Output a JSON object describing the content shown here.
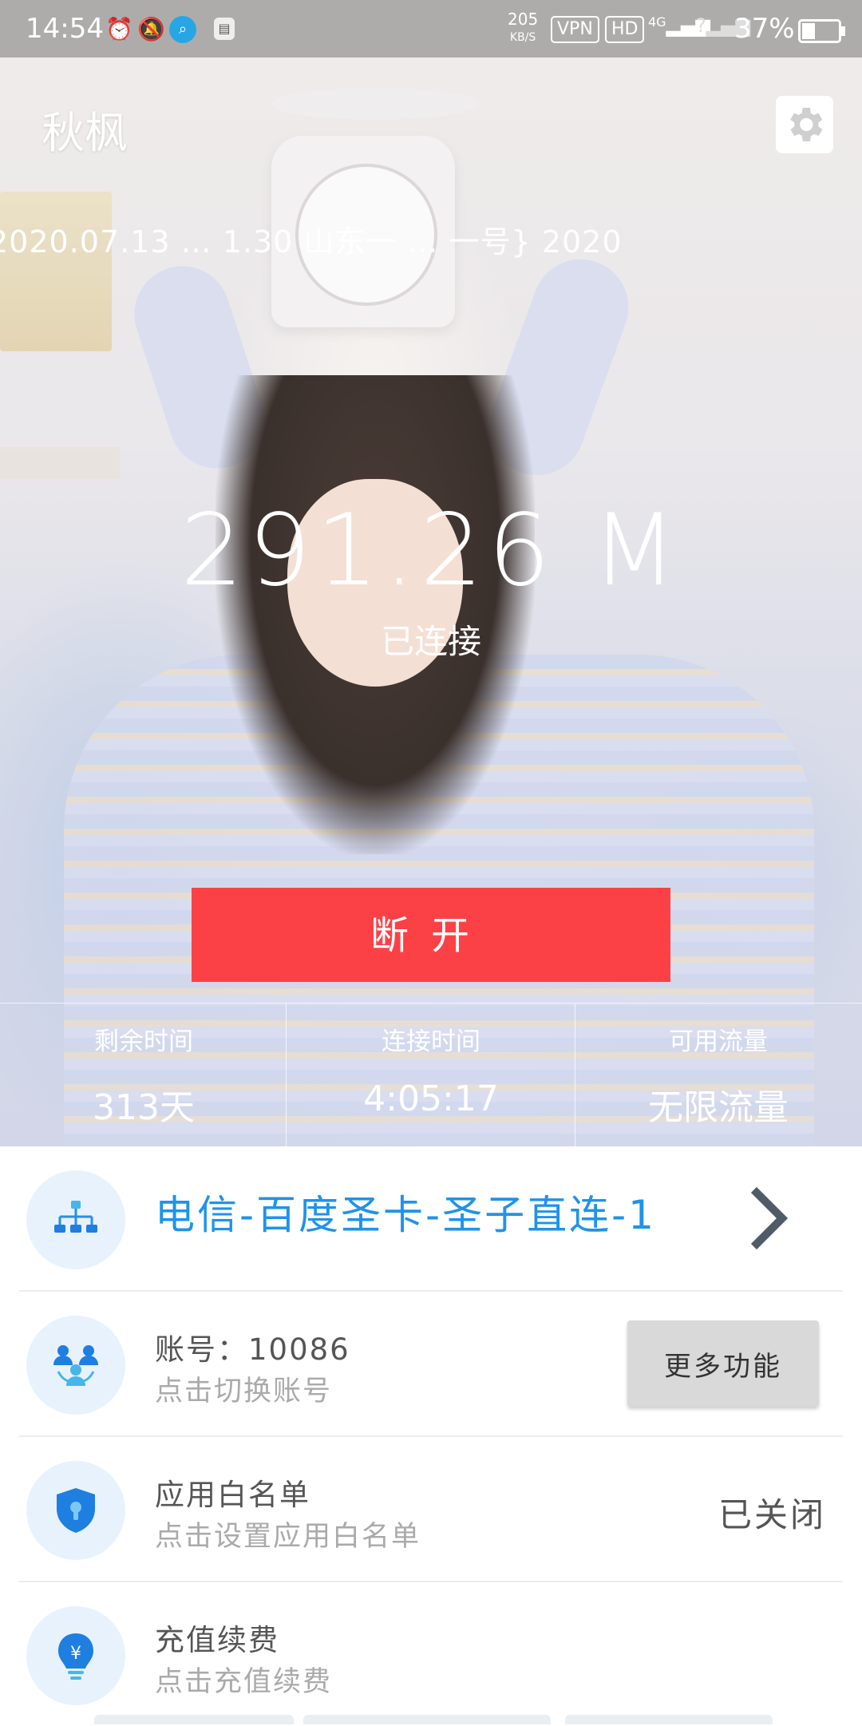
{
  "status_bar": {
    "time": "14:54",
    "speed_value": "205",
    "speed_unit": "KB/S",
    "vpn": "VPN",
    "hd": "HD",
    "network": "4G",
    "battery": "37%"
  },
  "header": {
    "app_title": "秋枫",
    "marquee": "2020.07.13 … 1.30   山东一 …   一号} 2020"
  },
  "connection": {
    "speed": "291.26 M",
    "status": "已连接",
    "disconnect_label": "断开"
  },
  "stats": [
    {
      "label": "剩余时间",
      "value": "313天"
    },
    {
      "label": "连接时间",
      "value": "4:05:17"
    },
    {
      "label": "可用流量",
      "value": "无限流量"
    }
  ],
  "list": {
    "server": "电信-百度圣卡-圣子直连-1",
    "account_title": "账号：10086",
    "account_sub": "点击切换账号",
    "more_label": "更多功能",
    "whitelist_title": "应用白名单",
    "whitelist_sub": "点击设置应用白名单",
    "whitelist_status": "已关闭",
    "recharge_title": "充值续费",
    "recharge_sub": "点击充值续费"
  },
  "colors": {
    "accent_red": "#fc4146",
    "accent_blue": "#1e93e9",
    "icon_circle": "#e7f2fd"
  }
}
